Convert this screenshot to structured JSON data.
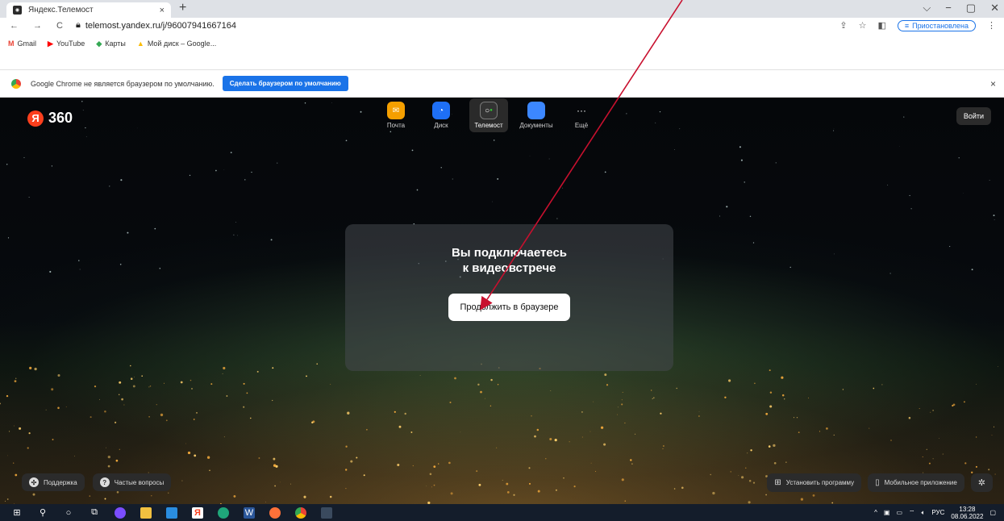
{
  "browser": {
    "tab_title": "Яндекс.Телемост",
    "tab_close": "×",
    "new_tab": "+",
    "window_controls": [
      "⌵",
      "−",
      "▢",
      "✕"
    ],
    "url": "telemost.yandex.ru/j/96007941667164",
    "profile_status": "Приостановлена",
    "bookmarks": [
      {
        "icon": "gmail-icon",
        "label": "Gmail",
        "color": "#ea4335"
      },
      {
        "icon": "youtube-icon",
        "label": "YouTube",
        "color": "#ff0000"
      },
      {
        "icon": "maps-icon",
        "label": "Карты",
        "color": "#34a853"
      },
      {
        "icon": "google-drive-icon",
        "label": "Мой диск – Google...",
        "color": "#fbbc05"
      }
    ],
    "infobar_text": "Google Chrome не является браузером по умолчанию.",
    "infobar_button": "Сделать браузером по умолчанию",
    "infobar_close": "×"
  },
  "header": {
    "logo_letter": "Я",
    "logo_text": "360",
    "apps": [
      {
        "label": "Почта",
        "icon": "mail-icon",
        "color": "#f59f00"
      },
      {
        "label": "Диск",
        "icon": "disk-icon",
        "color": "#1e6ff5"
      },
      {
        "label": "Телемост",
        "icon": "telemost-icon",
        "color": "#333333",
        "active": true
      },
      {
        "label": "Документы",
        "icon": "documents-icon",
        "color": "#3c87ff"
      },
      {
        "label": "Ещё",
        "icon": "more-icon",
        "color": "transparent"
      }
    ],
    "login": "Войти"
  },
  "main": {
    "title_line1": "Вы подключаетесь",
    "title_line2": "к видеовстрече",
    "continue_button": "Продолжить в браузере"
  },
  "footer": {
    "support": "Поддержка",
    "faq": "Частые вопросы",
    "install": "Установить программу",
    "mobile": "Мобильное приложение"
  },
  "taskbar": {
    "lang": "РУС",
    "time": "13:28",
    "date": "08.06.2022"
  },
  "colors": {
    "accent_blue": "#1a73e8",
    "yandex_red": "#fc3f1d",
    "annotation_arrow": "#c8102e"
  }
}
